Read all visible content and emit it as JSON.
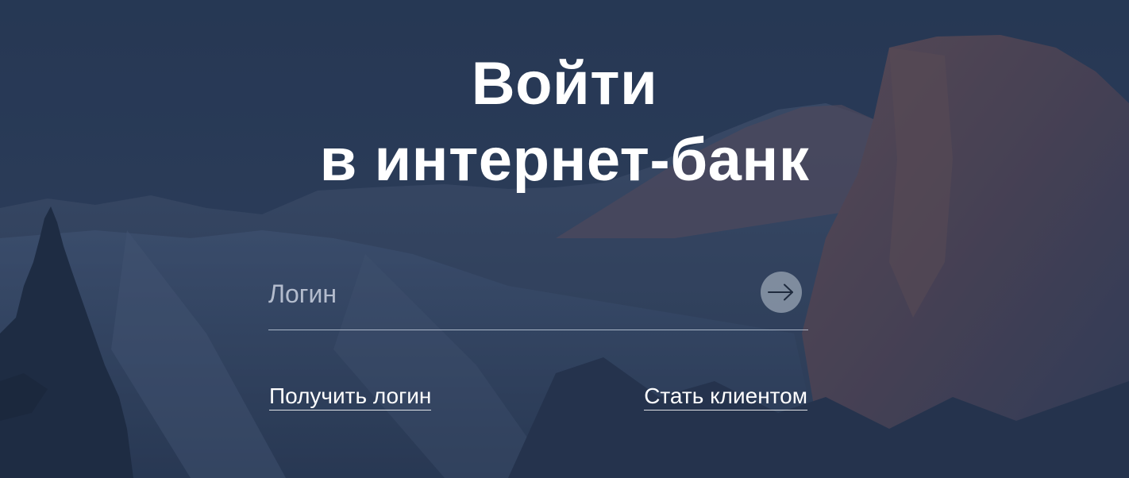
{
  "page": {
    "title_line1": "Войти",
    "title_line2": "в интернет-банк"
  },
  "login": {
    "placeholder": "Логин",
    "value": "",
    "submit_icon": "arrow-right-icon"
  },
  "links": {
    "get_login": "Получить логин",
    "become_client": "Стать клиентом"
  },
  "colors": {
    "overlay": "#22324c",
    "text": "#ffffff",
    "submit_button": "#aeb8c5"
  }
}
